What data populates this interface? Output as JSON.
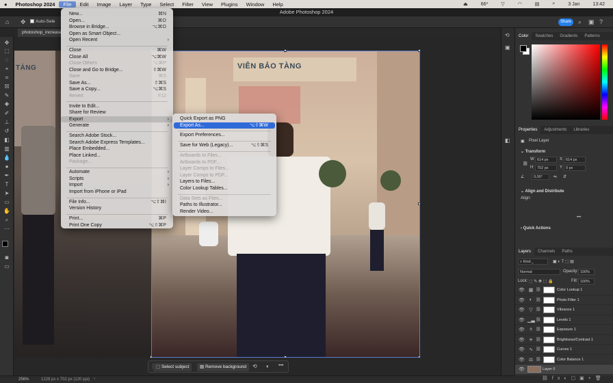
{
  "macbar": {
    "apple": "",
    "app": "Photoshop 2024",
    "menus": [
      "File",
      "Edit",
      "Image",
      "Layer",
      "Type",
      "Select",
      "Filter",
      "View",
      "Plugins",
      "Window",
      "Help"
    ],
    "battery": "66*",
    "date": "3 Jan",
    "time": "13:42"
  },
  "titlebar": {
    "title": "Adobe Photoshop 2024"
  },
  "optbar": {
    "auto_select": "Auto-Sele",
    "share": "Share"
  },
  "doc": {
    "tab": "photoshop_increase"
  },
  "photo": {
    "sign_main": "VIÊN BẢO TÀNG",
    "sign_left": "TÀNG"
  },
  "ctxbar": {
    "select_subject": "Select subject",
    "remove_bg": "Remove background",
    "more": "•••"
  },
  "status": {
    "zoom": "256%",
    "info": "1228 px x 702 px (120 ppi)"
  },
  "color_panel": {
    "tabs": [
      "Color",
      "Swatches",
      "Gradients",
      "Patterns"
    ]
  },
  "properties": {
    "tabs": [
      "Properties",
      "Adjustments",
      "Libraries"
    ],
    "kind": "Pixel Layer",
    "transform": "Transform",
    "w_label": "W",
    "w": "614 px",
    "x_label": "X",
    "x": "614 px",
    "h_label": "H",
    "h": "702 px",
    "y_label": "Y",
    "y": "0 px",
    "angle": "0,00°",
    "align": "Align and Distribute",
    "align_label": "Align:",
    "more": "•••",
    "quick": "Quick Actions"
  },
  "layers_panel": {
    "tabs": [
      "Layers",
      "Channels",
      "Paths"
    ],
    "kind": "Kind",
    "blend": "Normal",
    "opacity_label": "Opacity:",
    "opacity": "100%",
    "lock_label": "Lock:",
    "fill_label": "Fill:",
    "fill": "100%",
    "layers": [
      {
        "name": "Color Lookup 1",
        "icon": "▦"
      },
      {
        "name": "Photo Filter 1",
        "icon": "◐"
      },
      {
        "name": "Vibrance 1",
        "icon": "▽"
      },
      {
        "name": "Levels 1",
        "icon": "▁▃"
      },
      {
        "name": "Exposure 1",
        "icon": "±"
      },
      {
        "name": "Brightness/Contrast 1",
        "icon": "☀"
      },
      {
        "name": "Curves 1",
        "icon": "∿"
      },
      {
        "name": "Color Balance 1",
        "icon": "⚖"
      },
      {
        "name": "Layer 0",
        "icon": ""
      }
    ]
  },
  "file_menu": {
    "items": [
      {
        "label": "New...",
        "sc": "⌘N"
      },
      {
        "label": "Open...",
        "sc": "⌘O"
      },
      {
        "label": "Browse in Bridge...",
        "sc": "⌥⌘O"
      },
      {
        "label": "Open as Smart Object...",
        "sc": ""
      },
      {
        "label": "Open Recent",
        "sc": ""
      },
      {
        "label": "Close",
        "sc": "⌘W"
      },
      {
        "label": "Close All",
        "sc": "⌥⌘W"
      },
      {
        "label": "Close Others",
        "sc": "⌥⌘P"
      },
      {
        "label": "Close and Go to Bridge...",
        "sc": "⇧⌘W"
      },
      {
        "label": "Save",
        "sc": "⌘S"
      },
      {
        "label": "Save As...",
        "sc": "⇧⌘S"
      },
      {
        "label": "Save a Copy...",
        "sc": "⌥⌘S"
      },
      {
        "label": "Revert",
        "sc": "F12"
      },
      {
        "label": "Invite to Edit...",
        "sc": ""
      },
      {
        "label": "Share for Review",
        "sc": ""
      },
      {
        "label": "Export",
        "sc": ""
      },
      {
        "label": "Generate",
        "sc": ""
      },
      {
        "label": "Search Adobe Stock...",
        "sc": ""
      },
      {
        "label": "Search Adobe Express Templates...",
        "sc": ""
      },
      {
        "label": "Place Embedded...",
        "sc": ""
      },
      {
        "label": "Place Linked...",
        "sc": ""
      },
      {
        "label": "Package...",
        "sc": ""
      },
      {
        "label": "Automate",
        "sc": ""
      },
      {
        "label": "Scripts",
        "sc": ""
      },
      {
        "label": "Import",
        "sc": ""
      },
      {
        "label": "Import from iPhone or iPad",
        "sc": ""
      },
      {
        "label": "File Info...",
        "sc": "⌥⇧⌘I"
      },
      {
        "label": "Version History",
        "sc": ""
      },
      {
        "label": "Print...",
        "sc": "⌘P"
      },
      {
        "label": "Print One Copy",
        "sc": "⌥⇧⌘P"
      }
    ]
  },
  "export_menu": {
    "items": [
      {
        "label": "Quick Export as PNG",
        "sc": ""
      },
      {
        "label": "Export As...",
        "sc": "⌥⇧⌘W"
      },
      {
        "label": "Export Preferences...",
        "sc": ""
      },
      {
        "label": "Save for Web (Legacy)...",
        "sc": "⌥⇧⌘S"
      },
      {
        "label": "Artboards to Files...",
        "sc": ""
      },
      {
        "label": "Artboards to PDF...",
        "sc": ""
      },
      {
        "label": "Layer Comps to Files...",
        "sc": ""
      },
      {
        "label": "Layer Comps to PDF...",
        "sc": ""
      },
      {
        "label": "Layers to Files...",
        "sc": ""
      },
      {
        "label": "Color Lookup Tables...",
        "sc": ""
      },
      {
        "label": "Data Sets as Files...",
        "sc": ""
      },
      {
        "label": "Paths to Illustrator...",
        "sc": ""
      },
      {
        "label": "Render Video...",
        "sc": ""
      }
    ]
  }
}
